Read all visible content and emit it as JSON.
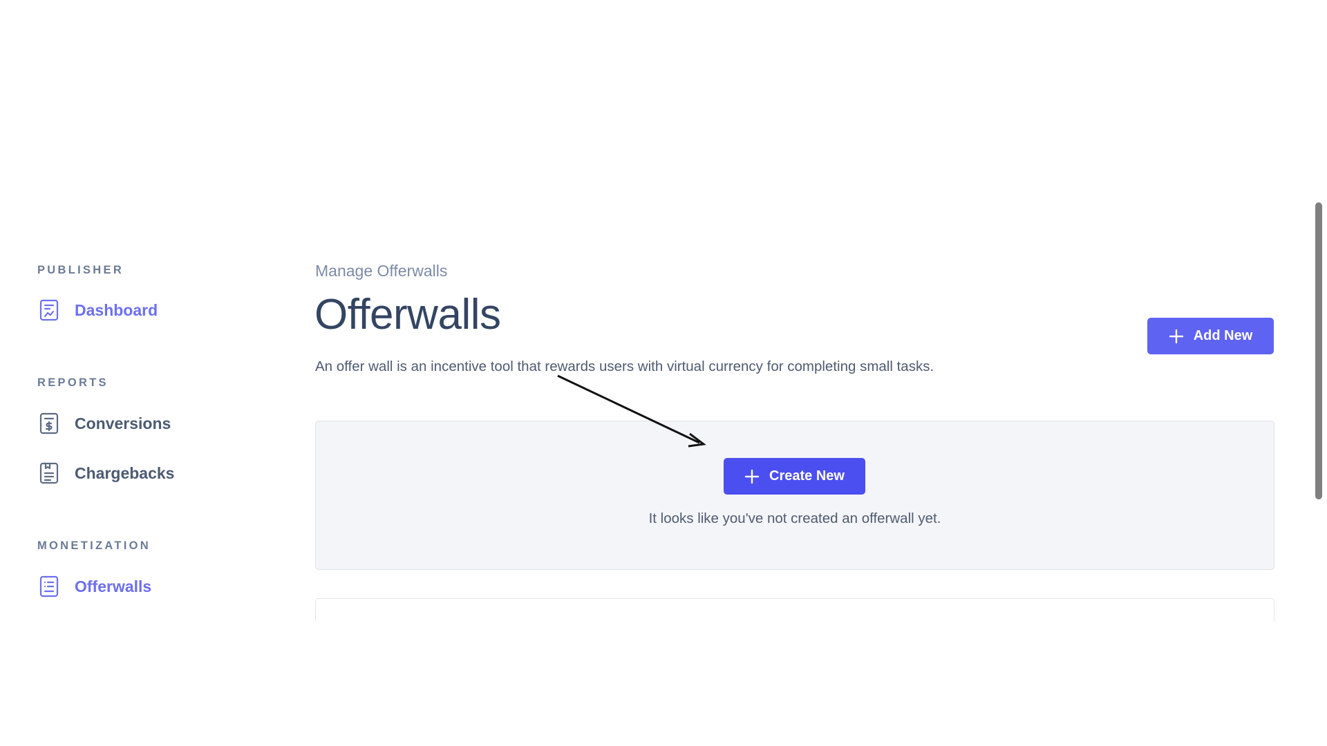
{
  "sidebar": {
    "sections": [
      {
        "heading": "PUBLISHER",
        "items": [
          {
            "label": "Dashboard",
            "icon": "dashboard-icon",
            "active": true
          }
        ]
      },
      {
        "heading": "REPORTS",
        "items": [
          {
            "label": "Conversions",
            "icon": "conversions-icon",
            "active": false
          },
          {
            "label": "Chargebacks",
            "icon": "chargebacks-icon",
            "active": false
          }
        ]
      },
      {
        "heading": "MONETIZATION",
        "items": [
          {
            "label": "Offerwalls",
            "icon": "offerwalls-icon",
            "active": true
          }
        ]
      }
    ]
  },
  "main": {
    "breadcrumb": "Manage Offerwalls",
    "title": "Offerwalls",
    "description": "An offer wall is an incentive tool that rewards users with virtual currency for completing small tasks.",
    "add_new_label": "Add New",
    "create_new_label": "Create New",
    "empty_message": "It looks like you've not created an offerwall yet."
  },
  "colors": {
    "accent": "#5f63f2",
    "accent_dark": "#4c4ff0",
    "active_nav": "#6c6ff0",
    "text_dark": "#344563",
    "text_muted": "#7d8aa6",
    "panel_bg": "#f4f5f8"
  },
  "icons": [
    "dashboard-icon",
    "conversions-icon",
    "chargebacks-icon",
    "offerwalls-icon",
    "plus-icon",
    "annotation-arrow"
  ]
}
